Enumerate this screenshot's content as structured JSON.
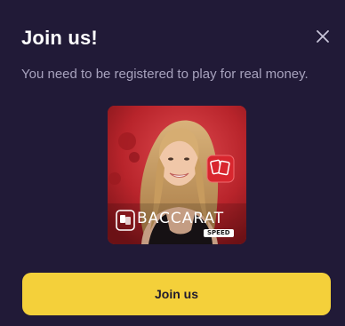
{
  "modal": {
    "title": "Join us!",
    "subtitle": "You need to be registered to play for real money.",
    "close_icon": "close-icon"
  },
  "game": {
    "name": "BACCARAT",
    "variant": "SPEED",
    "logo_icon": "baccarat-logo-icon",
    "card_badge_icon": "playing-cards-icon"
  },
  "cta": {
    "label": "Join us"
  },
  "colors": {
    "background": "#211a37",
    "title": "#ffffff",
    "subtitle": "#a7a2bd",
    "accent": "#f4d03a",
    "thumbnail_red": "#b9232b"
  }
}
